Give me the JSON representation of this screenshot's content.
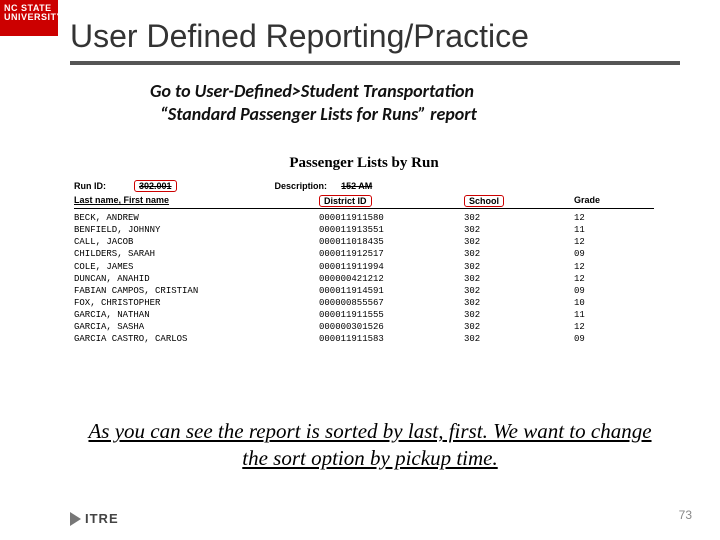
{
  "brand": {
    "line1": "NC STATE",
    "line2": "UNIVERSITY"
  },
  "title": "User Defined Reporting/Practice",
  "instruction_line1": "Go to User-Defined>Student Transportation",
  "instruction_line2": "“Standard Passenger Lists for Runs” report",
  "report": {
    "heading": "Passenger Lists by Run",
    "runid_label": "Run ID:",
    "runid_value": "302.001",
    "desc_label": "Description:",
    "desc_value": "152 AM",
    "col_name": "Last name, First name",
    "col_id": "District ID",
    "col_school": "School",
    "col_grade": "Grade",
    "rows": [
      {
        "name": "BECK, ANDREW",
        "id": "000011911580",
        "school": "302",
        "grade": "12"
      },
      {
        "name": "BENFIELD, JOHNNY",
        "id": "000011913551",
        "school": "302",
        "grade": "11"
      },
      {
        "name": "CALL, JACOB",
        "id": "000011018435",
        "school": "302",
        "grade": "12"
      },
      {
        "name": "CHILDERS, SARAH",
        "id": "000011912517",
        "school": "302",
        "grade": "09"
      },
      {
        "name": "COLE, JAMES",
        "id": "000011911994",
        "school": "302",
        "grade": "12"
      },
      {
        "name": "DUNCAN, ANAHID",
        "id": "000000421212",
        "school": "302",
        "grade": "12"
      },
      {
        "name": "FABIAN CAMPOS, CRISTIAN",
        "id": "000011914591",
        "school": "302",
        "grade": "09"
      },
      {
        "name": "FOX, CHRISTOPHER",
        "id": "000000855567",
        "school": "302",
        "grade": "10"
      },
      {
        "name": "GARCIA, NATHAN",
        "id": "000011911555",
        "school": "302",
        "grade": "11"
      },
      {
        "name": "GARCIA, SASHA",
        "id": "000000301526",
        "school": "302",
        "grade": "12"
      },
      {
        "name": "GARCIA CASTRO, CARLOS",
        "id": "000011911583",
        "school": "302",
        "grade": "09"
      }
    ]
  },
  "caption": "As you can see the report is sorted by last, first.  We want to change the sort option by pickup time.",
  "footer_logo": "ITRE",
  "page_number": "73"
}
